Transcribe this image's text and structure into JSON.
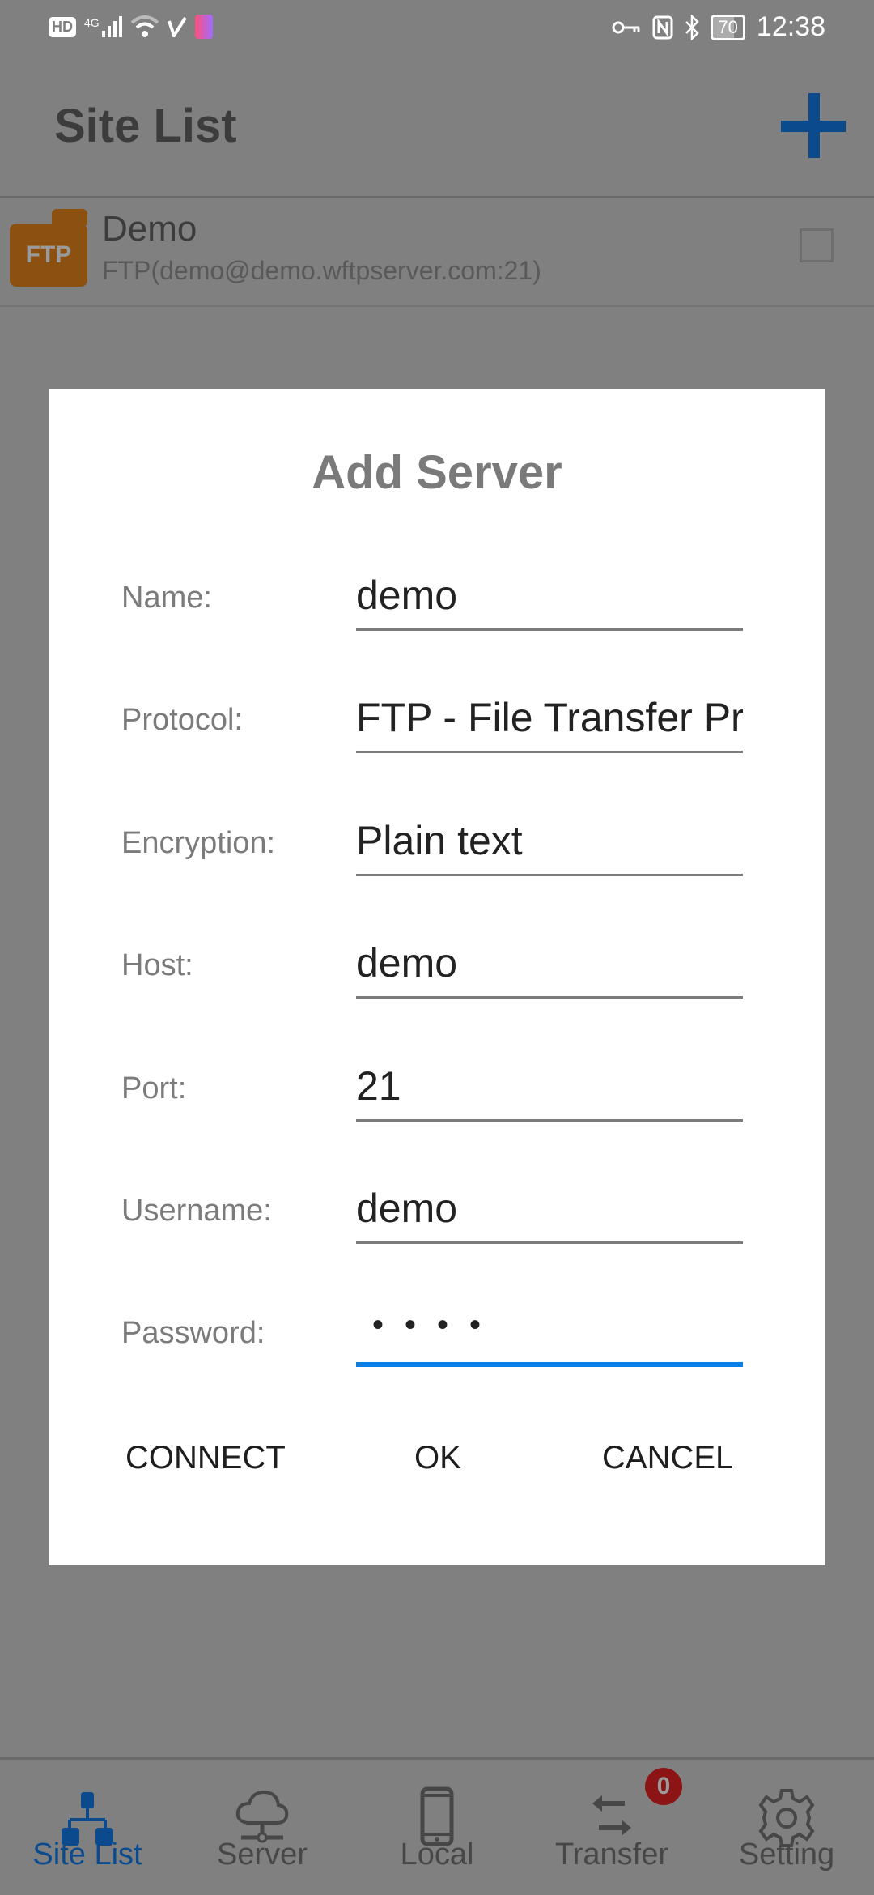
{
  "status_bar": {
    "left_icons": [
      "hd-icon",
      "4g-signal-icon",
      "wifi-icon",
      "vpn-check-icon",
      "app-notification-icon"
    ],
    "network_label": "4G",
    "hd_label": "HD",
    "right_icons": [
      "key-icon",
      "nfc-icon",
      "bluetooth-icon",
      "battery-icon"
    ],
    "battery_percent": 70,
    "battery_label": "70",
    "time": "12:38"
  },
  "header": {
    "title": "Site List",
    "add_icon": "plus-icon",
    "accent_color": "#0b4a8c"
  },
  "site_list": [
    {
      "icon_label": "FTP",
      "icon_color": "#8c5010",
      "name": "Demo",
      "subtitle": "FTP(demo@demo.wftpserver.com:21)",
      "checked": false
    }
  ],
  "dialog": {
    "title": "Add Server",
    "fields": [
      {
        "label": "Name:",
        "value": "demo"
      },
      {
        "label": "Protocol:",
        "value": "FTP - File Transfer Protocol"
      },
      {
        "label": "Encryption:",
        "value": "Plain text"
      },
      {
        "label": "Host:",
        "value": "demo"
      },
      {
        "label": "Port:",
        "value": "21"
      },
      {
        "label": "Username:",
        "value": "demo"
      },
      {
        "label": "Password:",
        "value": "••••",
        "masked": true,
        "focused": true
      }
    ],
    "buttons": {
      "connect": "CONNECT",
      "ok": "OK",
      "cancel": "CANCEL"
    },
    "focus_color": "#0a7fe8"
  },
  "bottom_nav": {
    "items": [
      {
        "label": "Site List",
        "icon": "sitemap-icon",
        "active": true
      },
      {
        "label": "Server",
        "icon": "cloud-server-icon",
        "active": false
      },
      {
        "label": "Local",
        "icon": "phone-icon",
        "active": false
      },
      {
        "label": "Transfer",
        "icon": "transfer-arrows-icon",
        "active": false,
        "badge": "0"
      },
      {
        "label": "Setting",
        "icon": "gear-icon",
        "active": false
      }
    ]
  }
}
